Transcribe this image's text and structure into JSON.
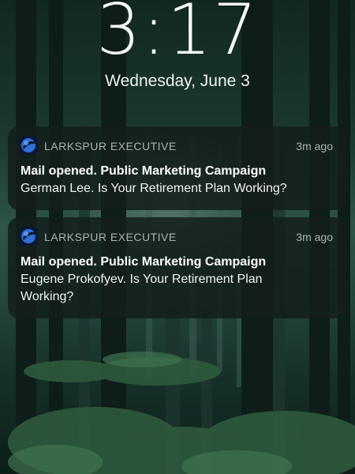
{
  "lockscreen": {
    "time": "3:17",
    "date": "Wednesday, June 3"
  },
  "notifications": [
    {
      "app_name": "LARKSPUR EXECUTIVE",
      "time_ago": "3m ago",
      "title": "Mail opened. Public Marketing Campaign",
      "body": "German Lee. Is Your Retirement Plan Working?",
      "icon": "app-logo-icon"
    },
    {
      "app_name": "LARKSPUR EXECUTIVE",
      "time_ago": "3m ago",
      "title": "Mail opened. Public Marketing Campaign",
      "body": "Eugene Prokofyev. Is Your Retirement Plan Working?",
      "icon": "app-logo-icon"
    }
  ],
  "colors": {
    "notification_bg": "#141e1c",
    "text_primary": "#ffffff",
    "text_secondary": "#a9b3b0",
    "app_icon_blue": "#2f6fd6"
  },
  "wallpaper": {
    "description_icon": "forest-wallpaper"
  }
}
